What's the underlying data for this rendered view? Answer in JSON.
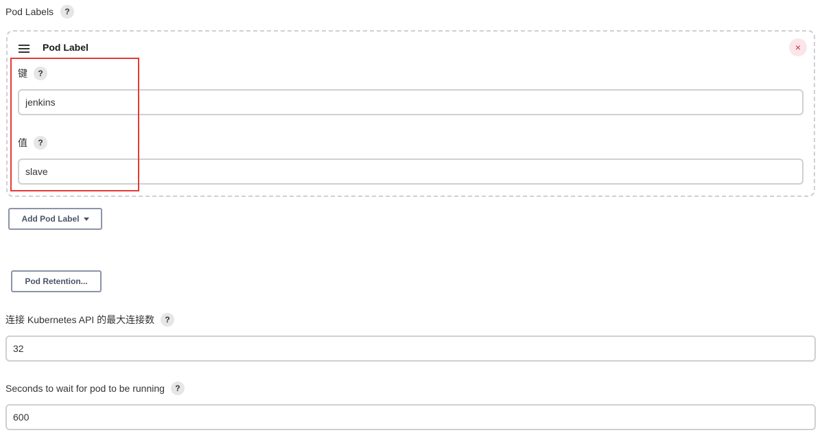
{
  "pod_labels": {
    "label": "Pod Labels",
    "help": "?",
    "item": {
      "title": "Pod Label",
      "close_symbol": "×",
      "key_label": "键",
      "key_help": "?",
      "key_value": "jenkins",
      "value_label": "值",
      "value_help": "?",
      "value_value": "slave"
    },
    "add_button": "Add Pod Label"
  },
  "pod_retention": {
    "button": "Pod Retention..."
  },
  "max_connections": {
    "label": "连接 Kubernetes API 的最大连接数",
    "help": "?",
    "value": "32"
  },
  "wait_seconds": {
    "label": "Seconds to wait for pod to be running",
    "help": "?",
    "value": "600"
  },
  "colors": {
    "highlight": "#e53935",
    "close": "#d0263f",
    "button_border": "#8b93a6",
    "input_border": "#cfcfd4"
  },
  "icons": {
    "drag": "hamburger-icon",
    "close": "close-icon",
    "help": "help-icon",
    "dropdown": "caret-down-icon"
  }
}
